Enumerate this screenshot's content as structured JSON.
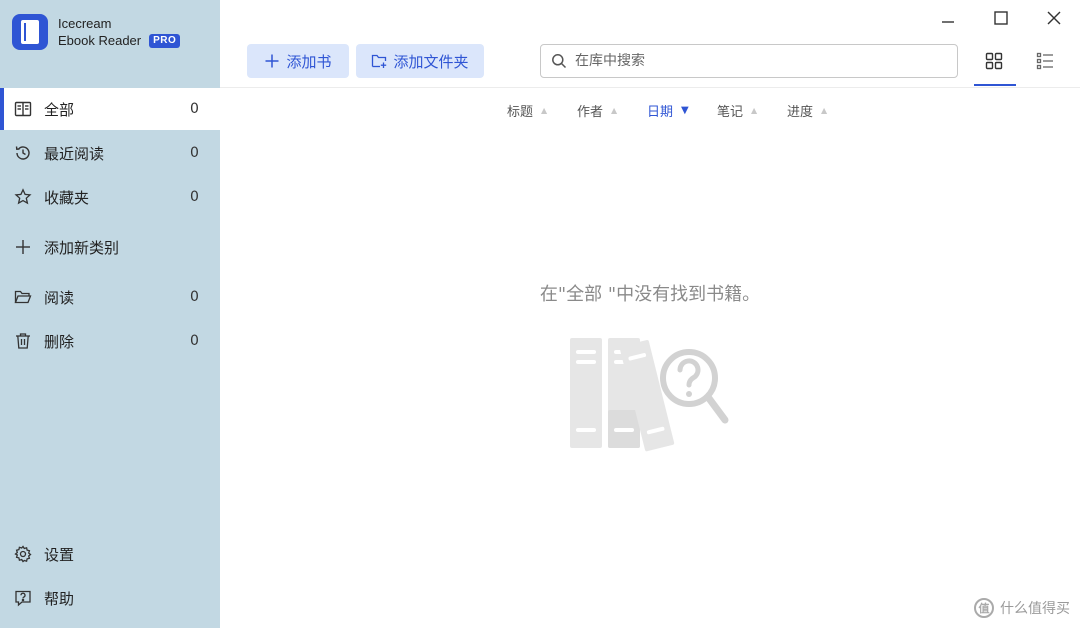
{
  "app": {
    "name_line1": "Icecream",
    "name_line2": "Ebook Reader",
    "badge": "PRO",
    "accent_color": "#2f55d4",
    "sidebar_color": "#c2d8e3"
  },
  "sidebar": {
    "items": [
      {
        "label": "全部",
        "count": "0",
        "icon": "book-open-icon",
        "active": true
      },
      {
        "label": "最近阅读",
        "count": "0",
        "icon": "history-icon"
      },
      {
        "label": "收藏夹",
        "count": "0",
        "icon": "star-icon"
      },
      {
        "label": "添加新类别",
        "count": "",
        "icon": "plus-icon"
      },
      {
        "label": "阅读",
        "count": "0",
        "icon": "folder-open-icon"
      },
      {
        "label": "删除",
        "count": "0",
        "icon": "trash-icon"
      }
    ],
    "footer": [
      {
        "label": "设置",
        "icon": "gear-icon"
      },
      {
        "label": "帮助",
        "icon": "help-icon"
      }
    ]
  },
  "toolbar": {
    "add_book": "添加书",
    "add_folder": "添加文件夹",
    "search_placeholder": "在库中搜索",
    "view_modes": [
      "grid-view-icon",
      "list-view-icon"
    ],
    "active_view": "grid"
  },
  "sort": {
    "columns": [
      "标题",
      "作者",
      "日期",
      "笔记",
      "进度"
    ],
    "active": "日期"
  },
  "empty_state": {
    "message": "在\"全部 \"中没有找到书籍。",
    "icon": "books-search-icon"
  },
  "watermark": {
    "text": "什么值得买",
    "mark": "值"
  }
}
